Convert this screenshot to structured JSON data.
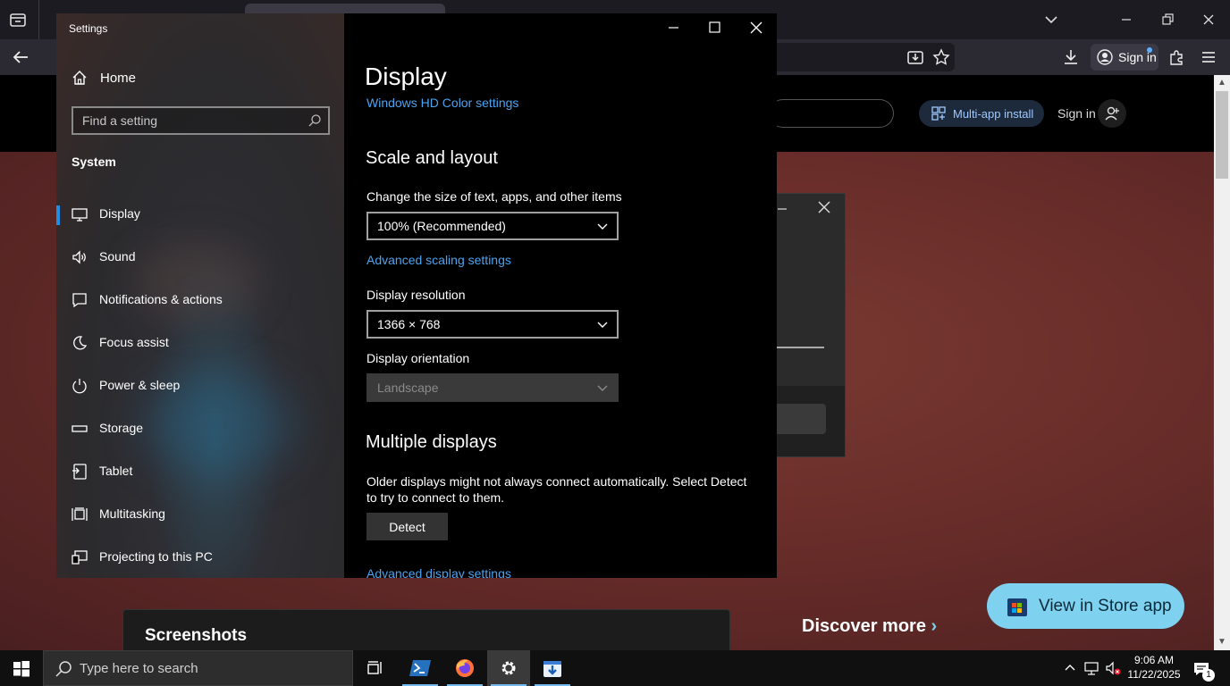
{
  "browser": {
    "signin_label": "Sign in"
  },
  "site": {
    "multiapp_label": "Multi-app install",
    "signin_label": "Sign in",
    "screenshots_title": "Screenshots",
    "discover_label": "Discover more",
    "store_button_label": "View in Store app"
  },
  "settings": {
    "window_title": "Settings",
    "home_label": "Home",
    "search_placeholder": "Find a setting",
    "section_title": "System",
    "nav": [
      {
        "label": "Display",
        "icon": "monitor-icon",
        "active": true
      },
      {
        "label": "Sound",
        "icon": "speaker-icon"
      },
      {
        "label": "Notifications & actions",
        "icon": "notification-icon"
      },
      {
        "label": "Focus assist",
        "icon": "moon-icon"
      },
      {
        "label": "Power & sleep",
        "icon": "power-icon"
      },
      {
        "label": "Storage",
        "icon": "storage-icon"
      },
      {
        "label": "Tablet",
        "icon": "tablet-icon"
      },
      {
        "label": "Multitasking",
        "icon": "multitasking-icon"
      },
      {
        "label": "Projecting to this PC",
        "icon": "projecting-icon"
      }
    ],
    "page_title": "Display",
    "hd_color_link": "Windows HD Color settings",
    "scale_heading": "Scale and layout",
    "scale_label": "Change the size of text, apps, and other items",
    "scale_value": "100% (Recommended)",
    "advanced_scaling_link": "Advanced scaling settings",
    "resolution_label": "Display resolution",
    "resolution_value": "1366 × 768",
    "orientation_label": "Display orientation",
    "orientation_value": "Landscape",
    "multiple_heading": "Multiple displays",
    "multiple_text": "Older displays might not always connect automatically. Select Detect to try to connect to them.",
    "detect_label": "Detect",
    "advanced_display_link": "Advanced display settings"
  },
  "taskbar": {
    "search_placeholder": "Type here to search",
    "time": "9:06 AM",
    "date": "11/22/2025",
    "notification_count": "1"
  },
  "colors": {
    "accent": "#1f8ce6",
    "link": "#4ca3f0",
    "store_button": "#7fd1f0"
  }
}
